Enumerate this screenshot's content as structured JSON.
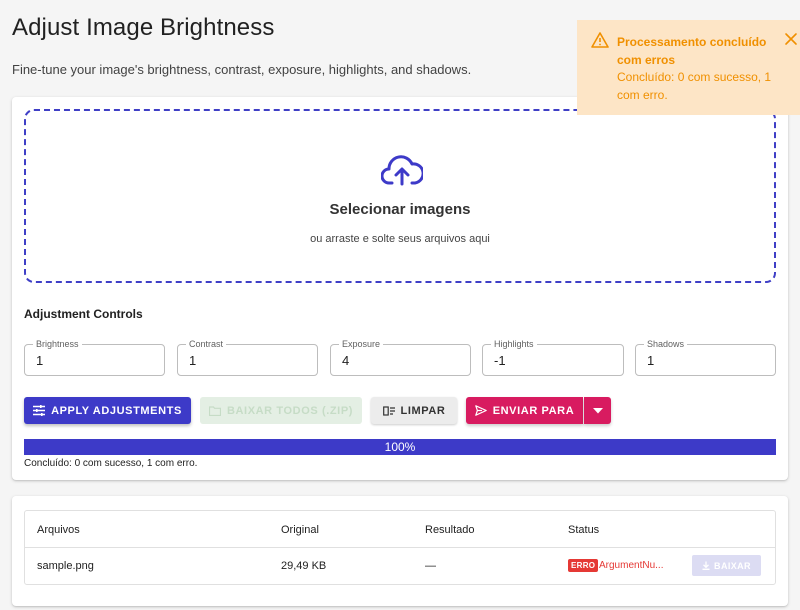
{
  "header": {
    "title": "Adjust Image Brightness",
    "subtitle": "Fine-tune your image's brightness, contrast, exposure, highlights, and shadows."
  },
  "dropzone": {
    "icon": "cloud-upload-icon",
    "title": "Selecionar imagens",
    "subtitle": "ou arraste e solte seus arquivos aqui"
  },
  "controls": {
    "title": "Adjustment Controls",
    "fields": [
      {
        "label": "Brightness",
        "value": "1"
      },
      {
        "label": "Contrast",
        "value": "1"
      },
      {
        "label": "Exposure",
        "value": "4"
      },
      {
        "label": "Highlights",
        "value": "-1"
      },
      {
        "label": "Shadows",
        "value": "1"
      }
    ]
  },
  "actions": {
    "apply": "APPLY ADJUSTMENTS",
    "download_all": "BAIXAR TODOS (.ZIP)",
    "clear": "LIMPAR",
    "send_to": "ENVIAR PARA"
  },
  "progress": {
    "percent": 100,
    "label": "100%",
    "caption": "Concluído: 0 com sucesso, 1 com erro."
  },
  "table": {
    "headers": [
      "Arquivos",
      "Original",
      "Resultado",
      "Status"
    ],
    "rows": [
      {
        "file": "sample.png",
        "original": "29,49 KB",
        "result": "—",
        "status_badge": "ERRO",
        "status_text": "ArgumentNu...",
        "action": "BAIXAR"
      }
    ]
  },
  "toast": {
    "title": "Processamento concluído com erros",
    "message": "Concluído: 0 com sucesso, 1 com erro."
  },
  "colors": {
    "primary": "#3d3ac8",
    "accent": "#d81b60",
    "error": "#e53935",
    "warning": "#f09000",
    "warning_bg": "#fde5c6"
  }
}
